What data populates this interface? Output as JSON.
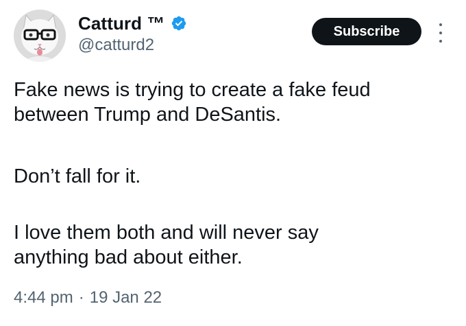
{
  "author": {
    "display_name": "Catturd ™",
    "handle": "@catturd2",
    "verified_icon": "verified-badge-icon",
    "verified_color": "#1d9bf0",
    "avatar_icon": "cat-with-glasses-avatar"
  },
  "actions": {
    "subscribe_label": "Subscribe",
    "subscribe_bg": "#0f1419",
    "more_icon": "more-vertical-icon"
  },
  "tweet": {
    "paragraphs": [
      {
        "lines": [
          "Fake news is trying to create a fake feud",
          "between Trump and DeSantis."
        ]
      },
      {
        "lines": [
          "Don’t fall for it."
        ]
      },
      {
        "lines": [
          "I love them both and will never say",
          "anything bad about either."
        ]
      }
    ]
  },
  "meta": {
    "time": "4:44 pm",
    "separator": "·",
    "date": "19 Jan 22"
  }
}
